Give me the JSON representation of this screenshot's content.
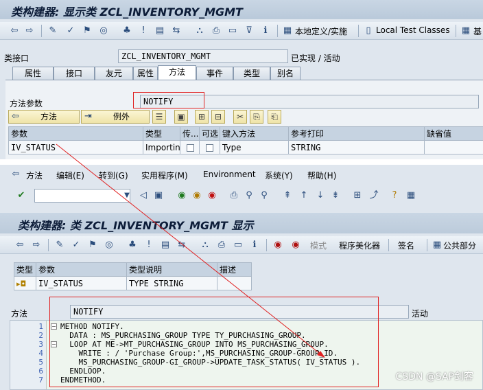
{
  "top": {
    "title": "类构建器: 显示类 ZCL_INVENTORY_MGMT",
    "toolbar": {
      "local_defs_label": "本地定义/实施",
      "local_test_label": "Local Test Classes",
      "base_label": "基"
    },
    "class_interface": {
      "label": "类接口",
      "value": "ZCL_INVENTORY_MGMT",
      "status": "已实现 / 活动"
    },
    "tabs": [
      "属性",
      "接口",
      "友元",
      "属性",
      "方法",
      "事件",
      "类型",
      "别名"
    ],
    "active_tab": "方法",
    "method_params": {
      "label": "方法参数",
      "value": "NOTIFY"
    },
    "buttons": {
      "method": "方法",
      "exception": "例外"
    },
    "param_table": {
      "headers": [
        "参数",
        "类型",
        "传...",
        "可选",
        "键入方法",
        "参考打印",
        "缺省值"
      ],
      "rows": [
        {
          "param": "IV_STATUS",
          "type": "Importin...",
          "typing": "Type",
          "ref": "STRING"
        }
      ]
    }
  },
  "bottom": {
    "menu": [
      "方法",
      "编辑(E)",
      "转到(G)",
      "实用程序(M)",
      "Environment",
      "系统(Y)",
      "帮助(H)"
    ],
    "title": "类构建器: 类 ZCL_INVENTORY_MGMT 显示",
    "toolbar": {
      "pattern_label": "模式",
      "pretty_printer_label": "程序美化器",
      "signature_label": "签名",
      "public_section_label": "公共部分"
    },
    "sig_table": {
      "headers": [
        "类型",
        "参数",
        "类型说明",
        "描述"
      ],
      "rows": [
        {
          "param": "IV_STATUS",
          "desc": "TYPE STRING"
        }
      ]
    },
    "method": {
      "label": "方法",
      "value": "NOTIFY",
      "status": "活动"
    },
    "code": {
      "line_numbers": [
        "1",
        "2",
        "3",
        "4",
        "5",
        "6",
        "7"
      ],
      "lines": [
        "METHOD NOTIFY.",
        "  DATA : MS_PURCHASING_GROUP TYPE TY_PURCHASING_GROUP.",
        "  LOOP AT ME->MT_PURCHASING_GROUP INTO MS_PURCHASING_GROUP.",
        "    WRITE : / 'Purchase Group:',MS_PURCHASING_GROUP-GROUP_ID.",
        "    MS_PURCHASING_GROUP-GI_GROUP->UPDATE_TASK_STATUS( IV_STATUS ).",
        "  ENDLOOP.",
        "ENDMETHOD."
      ]
    }
  },
  "watermark": "CSDN @SAP剑客",
  "colors": {
    "titlebar": "#c9d6e4",
    "panel_bg": "#dfe6ee",
    "highlight_box": "#e02020",
    "button_yellow": "#efe4a8",
    "code_keyword": "#1b3ca8",
    "code_string": "#3a7a3a"
  }
}
